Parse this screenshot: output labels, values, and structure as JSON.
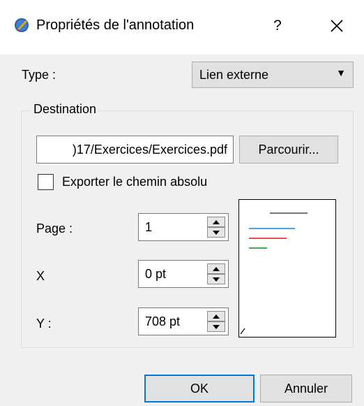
{
  "window": {
    "title": "Propriétés de l'annotation",
    "help_label": "?",
    "close_label": "✕"
  },
  "type": {
    "label": "Type :",
    "selected": "Lien externe"
  },
  "destination": {
    "group_title": "Destination",
    "path_value": ")17/Exercices/Exercices.pdf",
    "browse_label": "Parcourir...",
    "export_absolute_label": "Exporter le chemin absolu",
    "export_absolute_checked": false,
    "page_label": "Page :",
    "page_value": "1",
    "x_label": "X",
    "x_value": "0 pt",
    "y_label": "Y :",
    "y_value": "708 pt"
  },
  "buttons": {
    "ok": "OK",
    "cancel": "Annuler"
  },
  "colors": {
    "accent": "#0078d7",
    "preview_blue": "#4aa0e6",
    "preview_red": "#e05050",
    "preview_green": "#3cb050"
  }
}
